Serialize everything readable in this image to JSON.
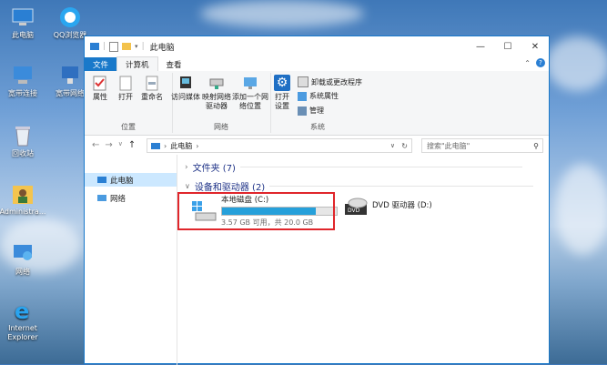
{
  "desktop": {
    "icons": [
      {
        "label": "此电脑"
      },
      {
        "label": "QQ浏览器"
      },
      {
        "label": "宽带连接"
      },
      {
        "label": "宽带网络"
      },
      {
        "label": "回收站"
      },
      {
        "label": "Administra..."
      },
      {
        "label": "网络"
      },
      {
        "label": "Internet Explorer"
      }
    ]
  },
  "window": {
    "title": "此电脑",
    "controls": {
      "minimize": "—",
      "maximize": "☐",
      "close": "✕"
    }
  },
  "ribbon_tabs": {
    "file": "文件",
    "computer": "计算机",
    "view": "查看"
  },
  "ribbon": {
    "location": {
      "name": "位置",
      "properties": "属性",
      "open": "打开",
      "rename": "重命名"
    },
    "network": {
      "name": "网络",
      "access_media": "访问媒体",
      "map_drive": "映射网络驱动器",
      "add_location": "添加一个网络位置"
    },
    "system": {
      "name": "系统",
      "open_settings": "打开设置",
      "uninstall": "卸载或更改程序",
      "system_properties": "系统属性",
      "manage": "管理"
    }
  },
  "address": {
    "path": "此电脑",
    "search_placeholder": "搜索\"此电脑\""
  },
  "nav": {
    "items": [
      {
        "label": "此电脑"
      },
      {
        "label": "网络"
      }
    ]
  },
  "content": {
    "folders_header": "文件夹 (7)",
    "devices_header": "设备和驱动器 (2)",
    "drives": [
      {
        "name": "本地磁盘 (C:)",
        "detail": "3.57 GB 可用，共 20.0 GB",
        "used_fraction": 0.82
      },
      {
        "name": "DVD 驱动器 (D:)"
      }
    ]
  }
}
